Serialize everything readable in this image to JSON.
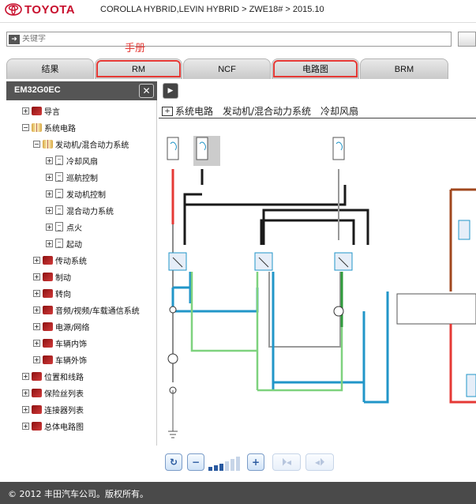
{
  "header": {
    "logo_text": "TOYOTA",
    "breadcrumb": "COROLLA HYBRID,LEVIN HYBRID > ZWE18# > 2015.10"
  },
  "search": {
    "placeholder": "关键字"
  },
  "annotation": {
    "label": "手册",
    "color": "#e53935"
  },
  "tabs": [
    {
      "label": "结果",
      "highlighted": false
    },
    {
      "label": "RM",
      "highlighted": true
    },
    {
      "label": "NCF",
      "highlighted": false
    },
    {
      "label": "电路图",
      "highlighted": true
    },
    {
      "label": "BRM",
      "highlighted": false
    }
  ],
  "sidebar": {
    "title": "EM32G0EC",
    "close_icon": "close-icon",
    "items": [
      {
        "label": "导言",
        "icon": "book-closed-icon",
        "expander": "+"
      },
      {
        "label": "系统电路",
        "icon": "book-open-icon",
        "expander": "−"
      },
      {
        "label": "发动机/混合动力系统",
        "icon": "book-open-icon",
        "expander": "−"
      },
      {
        "label": "冷却风扇",
        "icon": "page-icon",
        "expander": "+",
        "selected": true
      },
      {
        "label": "巡航控制",
        "icon": "page-icon",
        "expander": "+"
      },
      {
        "label": "发动机控制",
        "icon": "page-icon",
        "expander": "+"
      },
      {
        "label": "混合动力系统",
        "icon": "page-icon",
        "expander": "+"
      },
      {
        "label": "点火",
        "icon": "page-icon",
        "expander": "+"
      },
      {
        "label": "起动",
        "icon": "page-icon",
        "expander": "+"
      },
      {
        "label": "传动系统",
        "icon": "book-closed-icon",
        "expander": "+"
      },
      {
        "label": "制动",
        "icon": "book-closed-icon",
        "expander": "+"
      },
      {
        "label": "转向",
        "icon": "book-closed-icon",
        "expander": "+"
      },
      {
        "label": "音频/视频/车载通信系统",
        "icon": "book-closed-icon",
        "expander": "+"
      },
      {
        "label": "电源/网络",
        "icon": "book-closed-icon",
        "expander": "+"
      },
      {
        "label": "车辆内饰",
        "icon": "book-closed-icon",
        "expander": "+"
      },
      {
        "label": "车辆外饰",
        "icon": "book-closed-icon",
        "expander": "+"
      },
      {
        "label": "位置和线路",
        "icon": "book-closed-icon",
        "expander": "+"
      },
      {
        "label": "保险丝列表",
        "icon": "book-closed-icon",
        "expander": "+"
      },
      {
        "label": "连接器列表",
        "icon": "book-closed-icon",
        "expander": "+"
      },
      {
        "label": "总体电路图",
        "icon": "book-closed-icon",
        "expander": "+"
      }
    ]
  },
  "content": {
    "box_glyph": "+",
    "title": "系统电路　发动机/混合动力系统　冷却风扇"
  },
  "toolbar": {
    "buttons": [
      "refresh-icon",
      "zoom-out-icon",
      "zoom-in-icon",
      "first-page-icon",
      "prev-page-icon",
      "next-page-icon",
      "last-page-icon"
    ],
    "zoom_level_fraction": 0.5
  },
  "footer": {
    "copyright": "© 2012 丰田汽车公司。版权所有。"
  },
  "colors": {
    "brand_red": "#c8102e",
    "wire_red": "#e53935",
    "wire_black": "#1a1a1a",
    "wire_blue": "#2196c8",
    "wire_green": "#7ed27e",
    "wire_dark_green": "#2e9a3a",
    "wire_brown": "#a0471e",
    "wire_gray": "#999999"
  }
}
